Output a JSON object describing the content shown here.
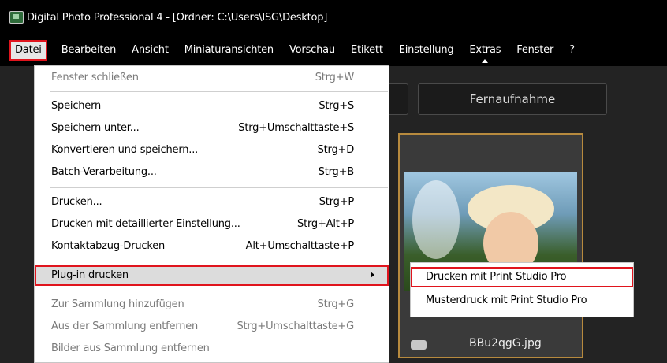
{
  "window": {
    "title": "Digital Photo Professional 4 - [Ordner: C:\\Users\\ISG\\Desktop]"
  },
  "menubar": {
    "items": [
      {
        "label": "Datei"
      },
      {
        "label": "Bearbeiten"
      },
      {
        "label": "Ansicht"
      },
      {
        "label": "Miniaturansichten"
      },
      {
        "label": "Vorschau"
      },
      {
        "label": "Etikett"
      },
      {
        "label": "Einstellung"
      },
      {
        "label": "Extras"
      },
      {
        "label": "Fenster"
      },
      {
        "label": "?"
      }
    ]
  },
  "toolbar": {
    "remote_label": "Fernaufnahme"
  },
  "thumbnail": {
    "filename": "BBu2qgG.jpg"
  },
  "file_menu": {
    "items": [
      {
        "label": "Fenster schließen",
        "shortcut": "Strg+W"
      },
      {
        "label": "Speichern",
        "shortcut": "Strg+S"
      },
      {
        "label": "Speichern unter...",
        "shortcut": "Strg+Umschalttaste+S"
      },
      {
        "label": "Konvertieren und speichern...",
        "shortcut": "Strg+D"
      },
      {
        "label": "Batch-Verarbeitung...",
        "shortcut": "Strg+B"
      },
      {
        "label": "Drucken...",
        "shortcut": "Strg+P"
      },
      {
        "label": "Drucken mit detaillierter Einstellung...",
        "shortcut": "Strg+Alt+P"
      },
      {
        "label": "Kontaktabzug-Drucken",
        "shortcut": "Alt+Umschalttaste+P"
      },
      {
        "label": "Plug-in drucken",
        "shortcut": ""
      },
      {
        "label": "Zur Sammlung hinzufügen",
        "shortcut": "Strg+G"
      },
      {
        "label": "Aus der Sammlung entfernen",
        "shortcut": "Strg+Umschalttaste+G"
      },
      {
        "label": "Bilder aus Sammlung entfernen",
        "shortcut": ""
      }
    ]
  },
  "plugin_submenu": {
    "items": [
      {
        "label": "Drucken mit Print Studio Pro"
      },
      {
        "label": "Musterdruck mit Print Studio Pro"
      }
    ]
  },
  "colors": {
    "highlight_outline": "#e0141d",
    "thumb_border": "#b78a3e"
  }
}
